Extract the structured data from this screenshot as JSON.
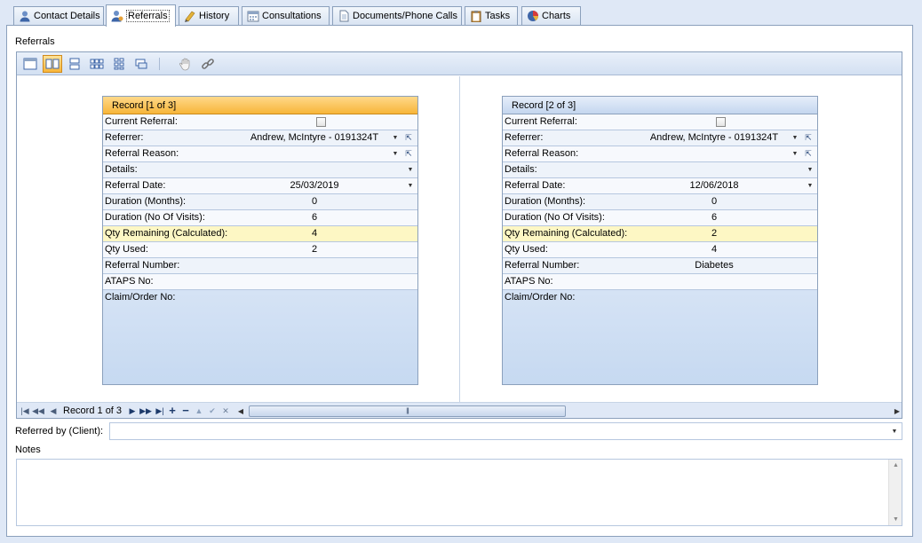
{
  "tabs": [
    {
      "label": "Contact Details",
      "icon": "contact-icon",
      "active": false
    },
    {
      "label": "Referrals",
      "icon": "referral-person-icon",
      "active": true
    },
    {
      "label": "History",
      "icon": "history-icon",
      "active": false
    },
    {
      "label": "Consultations",
      "icon": "calendar-icon",
      "active": false
    },
    {
      "label": "Documents/Phone Calls",
      "icon": "document-icon",
      "active": false
    },
    {
      "label": "Tasks",
      "icon": "clipboard-icon",
      "active": false
    },
    {
      "label": "Charts",
      "icon": "chart-globe-icon",
      "active": false
    }
  ],
  "section_title": "Referrals",
  "toolbar": {
    "buttons": [
      "single-record-view-icon",
      "columns-view-icon",
      "rows-view-icon",
      "multi-columns-view-icon",
      "multi-rows-view-icon",
      "customize-view-icon",
      "pan-hand-icon",
      "link-icon"
    ],
    "active_index": 1
  },
  "labels": {
    "current_referral": "Current Referral:",
    "referrer": "Referrer:",
    "referral_reason": "Referral Reason:",
    "details": "Details:",
    "referral_date": "Referral Date:",
    "duration_months": "Duration (Months):",
    "duration_visits": "Duration (No Of Visits):",
    "qty_remaining": "Qty Remaining (Calculated):",
    "qty_used": "Qty Used:",
    "referral_number": "Referral Number:",
    "ataps_no": "ATAPS No:",
    "claim_order_no": "Claim/Order No:"
  },
  "records": [
    {
      "header": "Record [1 of 3]",
      "selected": true,
      "current_referral": false,
      "referrer": "Andrew, McIntyre - 0191324T",
      "referral_reason": "",
      "details": "",
      "referral_date": "25/03/2019",
      "duration_months": "0",
      "duration_visits": "6",
      "qty_remaining": "4",
      "qty_used": "2",
      "referral_number": "",
      "ataps_no": "",
      "claim_order_no": ""
    },
    {
      "header": "Record [2 of 3]",
      "selected": false,
      "current_referral": false,
      "referrer": "Andrew, McIntyre - 0191324T",
      "referral_reason": "",
      "details": "",
      "referral_date": "12/06/2018",
      "duration_months": "0",
      "duration_visits": "6",
      "qty_remaining": "2",
      "qty_used": "4",
      "referral_number": "Diabetes",
      "ataps_no": "",
      "claim_order_no": ""
    }
  ],
  "navigator": {
    "record_text": "Record 1 of 3",
    "buttons": [
      "first-icon",
      "prev-page-icon",
      "prev-icon",
      "next-icon",
      "next-page-icon",
      "last-icon",
      "add-icon",
      "delete-icon",
      "edit-icon",
      "post-icon",
      "cancel-icon"
    ]
  },
  "referred_by": {
    "label": "Referred by (Client):",
    "value": ""
  },
  "notes": {
    "label": "Notes",
    "value": ""
  }
}
